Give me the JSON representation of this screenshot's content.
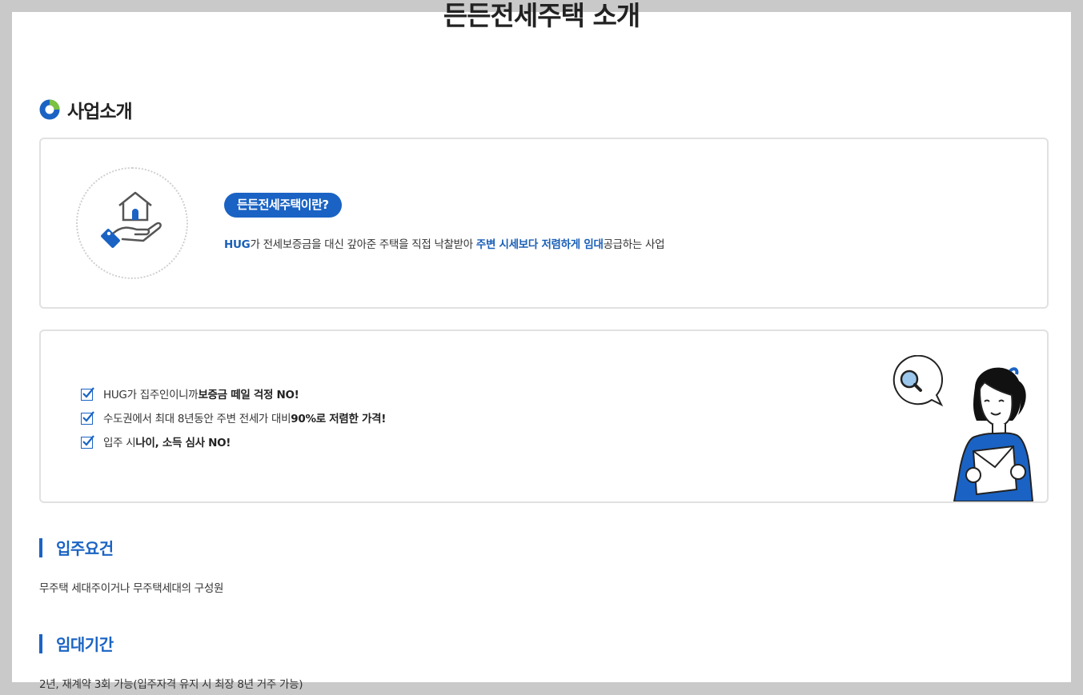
{
  "page": {
    "title": "든든전세주택 소개"
  },
  "section": {
    "title": "사업소개",
    "icon": "ring-icon"
  },
  "intro_card": {
    "icon": "house-hand-icon",
    "badge": "든든전세주택이란?",
    "desc_part1": "HUG",
    "desc_part2": "가 전세보증금을 대신 갚아준 주택을 직접 낙찰받아 ",
    "desc_part3": "주변 시세보다 저렴하게 임대",
    "desc_part4": "공급하는 사업"
  },
  "benefits": [
    {
      "plain": "HUG가 집주인이니까 ",
      "bold": "보증금 떼일 걱정 NO!"
    },
    {
      "plain": "수도권에서 최대 8년동안 주변 전세가 대비 ",
      "bold": "90%로 저렴한 가격!"
    },
    {
      "plain": "입주 시 ",
      "bold": "나이, 소득 심사 NO!"
    }
  ],
  "illustration": "girl-with-magnifier-illustration",
  "requirements": {
    "title": "입주요건",
    "text": "무주택 세대주이거나 무주택세대의 구성원"
  },
  "lease_period": {
    "title": "임대기간",
    "text": "2년, 재계약 3회 가능(입주자격 유지 시 최장 8년 거주 가능)"
  },
  "colors": {
    "accent": "#1a63c4",
    "ring_green": "#7bc142",
    "background": "#c9c9c9"
  }
}
